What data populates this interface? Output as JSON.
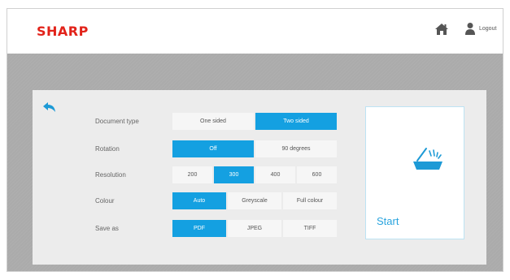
{
  "header": {
    "logo": "SHARP",
    "home_icon": "home-icon",
    "user_icon": "user-icon",
    "logout_label": "Logout"
  },
  "colors": {
    "accent": "#14a0e1",
    "brand": "#e2231a",
    "background": "#ababab",
    "panel": "#ececec"
  },
  "panel": {
    "back_icon": "back-arrow-icon",
    "rows": [
      {
        "label": "Document type",
        "options": [
          "One sided",
          "Two sided"
        ],
        "selected": "Two sided"
      },
      {
        "label": "Rotation",
        "options": [
          "Off",
          "90 degrees"
        ],
        "selected": "Off"
      },
      {
        "label": "Resolution",
        "options": [
          "200",
          "300",
          "400",
          "600"
        ],
        "selected": "300"
      },
      {
        "label": "Colour",
        "options": [
          "Auto",
          "Greyscale",
          "Full colour"
        ],
        "selected": "Auto"
      },
      {
        "label": "Save as",
        "options": [
          "PDF",
          "JPEG",
          "TIFF"
        ],
        "selected": "PDF"
      }
    ],
    "start": {
      "label": "Start",
      "icon": "scanner-icon"
    }
  }
}
